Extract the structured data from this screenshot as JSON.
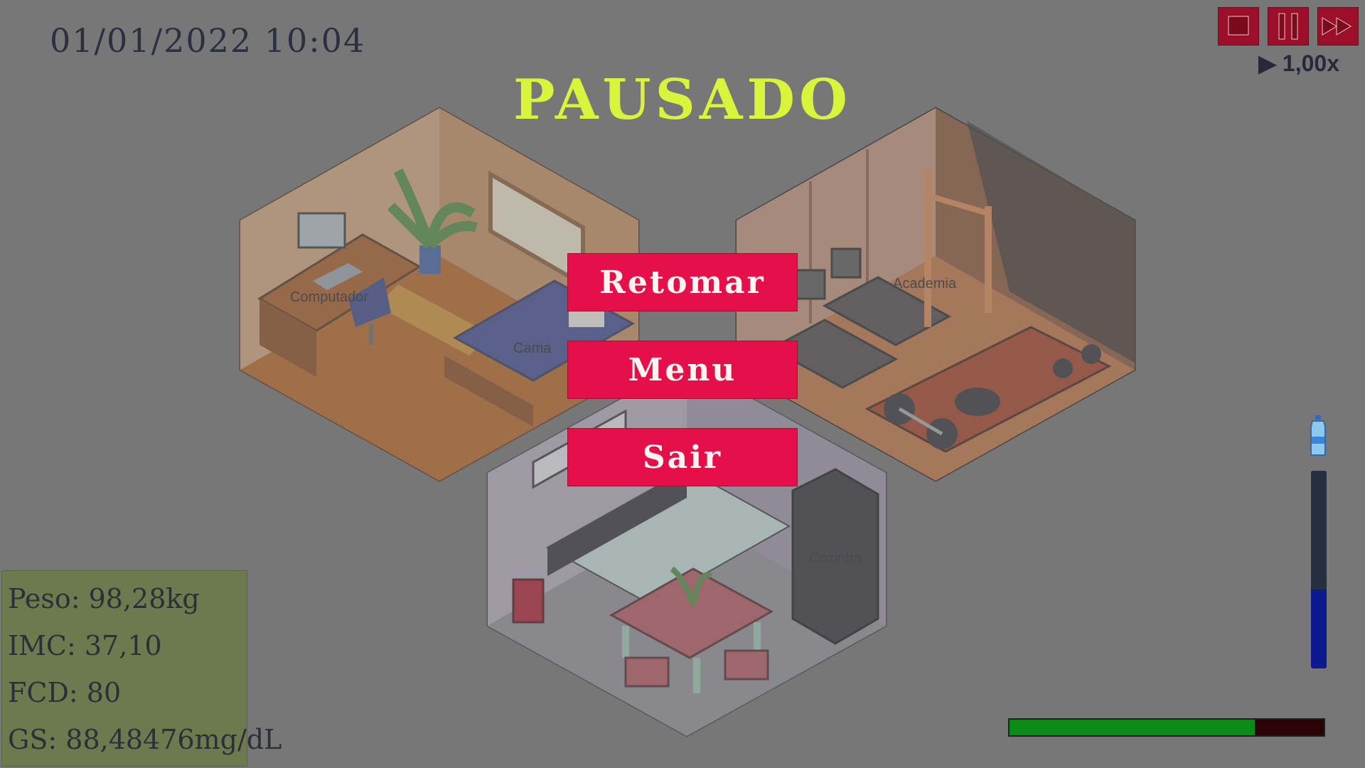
{
  "hud": {
    "datetime": "01/01/2022 10:04",
    "speed_label": "▶ 1,00x"
  },
  "pause": {
    "title": "PAUSADO",
    "resume_label": "Retomar",
    "menu_label": "Menu",
    "exit_label": "Sair"
  },
  "rooms": {
    "computer_label": "Computador",
    "bed_label": "Cama",
    "gym_label": "Academia",
    "kitchen_label": "Cozinha"
  },
  "stats": {
    "weight": "Peso: 98,28kg",
    "bmi": "IMC: 37,10",
    "fcd": "FCD: 80",
    "gs": "GS: 88,48476mg/dL"
  },
  "meters": {
    "water_level": 0.4,
    "energy_level": 0.78
  },
  "controls": {
    "stop_icon": "stop-icon",
    "pause_icon": "pause-icon",
    "fast_forward_icon": "fast-forward-icon"
  },
  "colors": {
    "button_red": "#e5104a",
    "title_yellow": "#d8f53c",
    "control_red": "#9b0f2a",
    "energy_green": "#0c8a17",
    "water_blue": "#0c1a8e"
  }
}
